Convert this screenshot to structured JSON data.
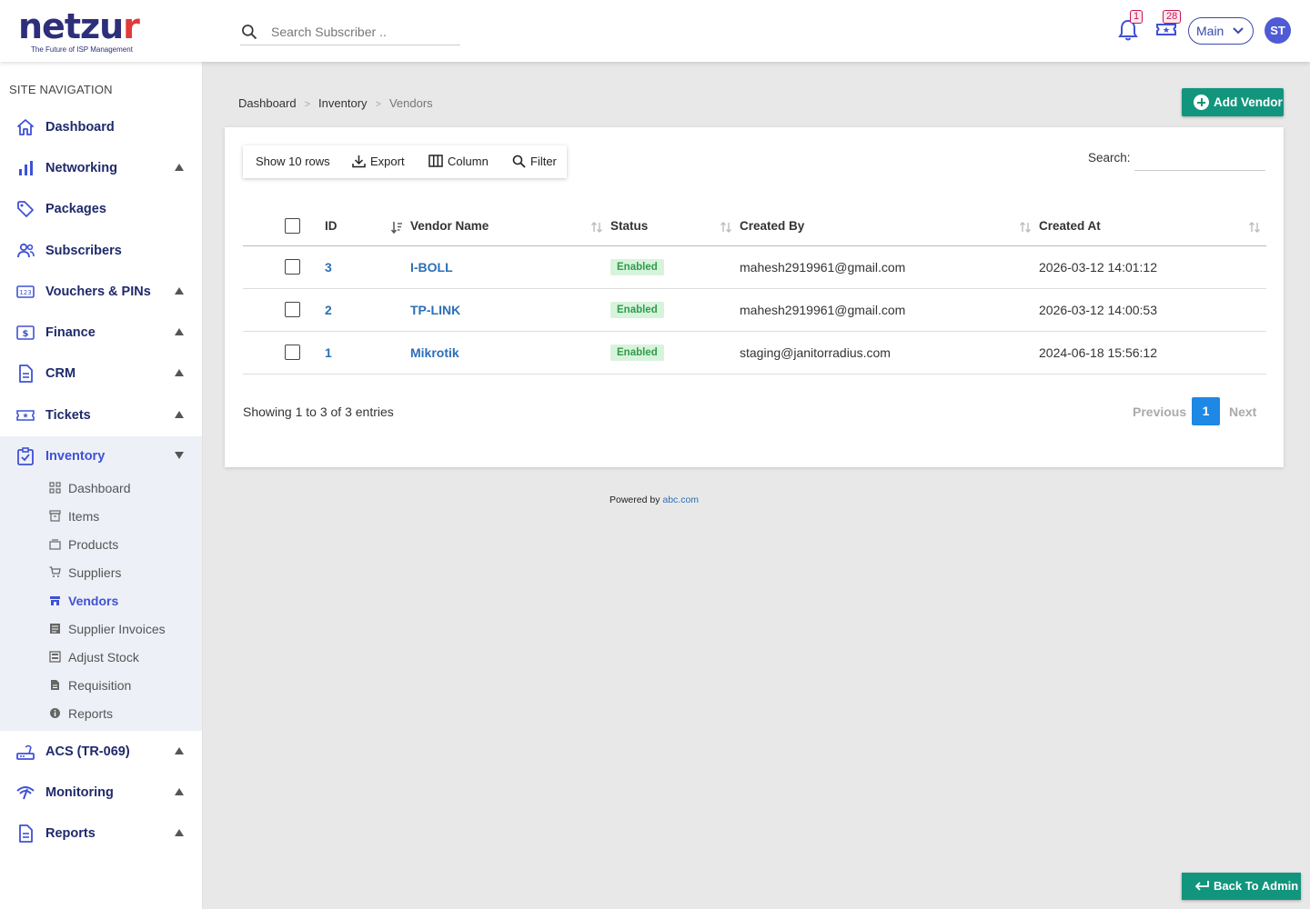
{
  "brand": {
    "name_main": "netzu",
    "name_last": "r",
    "tagline": "The Future of ISP Management"
  },
  "header": {
    "search_placeholder": "Search Subscriber ..",
    "notif_count": "1",
    "tickets_count": "28",
    "workspace": "Main",
    "avatar_initials": "ST"
  },
  "sidebar": {
    "title": "SITE NAVIGATION",
    "items": [
      {
        "label": "Dashboard",
        "icon": "home-icon"
      },
      {
        "label": "Networking",
        "icon": "bar-chart-icon"
      },
      {
        "label": "Packages",
        "icon": "tag-icon"
      },
      {
        "label": "Subscribers",
        "icon": "users-icon"
      },
      {
        "label": "Vouchers & PINs",
        "icon": "numbers-icon"
      },
      {
        "label": "Finance",
        "icon": "dollar-icon"
      },
      {
        "label": "CRM",
        "icon": "document-icon"
      },
      {
        "label": "Tickets",
        "icon": "ticket-icon"
      },
      {
        "label": "Inventory",
        "icon": "clipboard-check-icon"
      },
      {
        "label": "ACS (TR-069)",
        "icon": "router-icon"
      },
      {
        "label": "Monitoring",
        "icon": "signal-icon"
      },
      {
        "label": "Reports",
        "icon": "report-icon"
      }
    ],
    "inventory_sub": [
      {
        "label": "Dashboard",
        "icon": "grid-icon"
      },
      {
        "label": "Items",
        "icon": "archive-icon"
      },
      {
        "label": "Products",
        "icon": "layers-icon"
      },
      {
        "label": "Suppliers",
        "icon": "cart-icon"
      },
      {
        "label": "Vendors",
        "icon": "store-icon"
      },
      {
        "label": "Supplier Invoices",
        "icon": "invoice-icon"
      },
      {
        "label": "Adjust Stock",
        "icon": "adjust-icon"
      },
      {
        "label": "Requisition",
        "icon": "file-icon"
      },
      {
        "label": "Reports",
        "icon": "info-icon"
      }
    ]
  },
  "breadcrumb": {
    "home": "Dashboard",
    "section": "Inventory",
    "current": "Vendors"
  },
  "actions": {
    "add_vendor": "Add Vendor",
    "back_to_admin": "Back To Admin"
  },
  "table_tools": {
    "show_rows": "Show 10 rows",
    "export": "Export",
    "column": "Column",
    "filter": "Filter",
    "search_label": "Search:"
  },
  "table": {
    "columns": [
      "ID",
      "Vendor Name",
      "Status",
      "Created By",
      "Created At"
    ],
    "rows": [
      {
        "id": "3",
        "name": "I-BOLL",
        "status": "Enabled",
        "created_by": "mahesh2919961@gmail.com",
        "created_at": "2026-03-12 14:01:12"
      },
      {
        "id": "2",
        "name": "TP-LINK",
        "status": "Enabled",
        "created_by": "mahesh2919961@gmail.com",
        "created_at": "2026-03-12 14:00:53"
      },
      {
        "id": "1",
        "name": "Mikrotik",
        "status": "Enabled",
        "created_by": "staging@janitorradius.com",
        "created_at": "2024-06-18 15:56:12"
      }
    ]
  },
  "pagination": {
    "info": "Showing 1 to 3 of 3 entries",
    "previous": "Previous",
    "page": "1",
    "next": "Next"
  },
  "footer": {
    "text": "Powered by",
    "link": "abc.com"
  },
  "colors": {
    "primary": "#3f51d6",
    "accent": "#12957d",
    "nav_text": "#1f2a6b",
    "link": "#2c6fb7",
    "status_green": "#2e9d4a"
  }
}
